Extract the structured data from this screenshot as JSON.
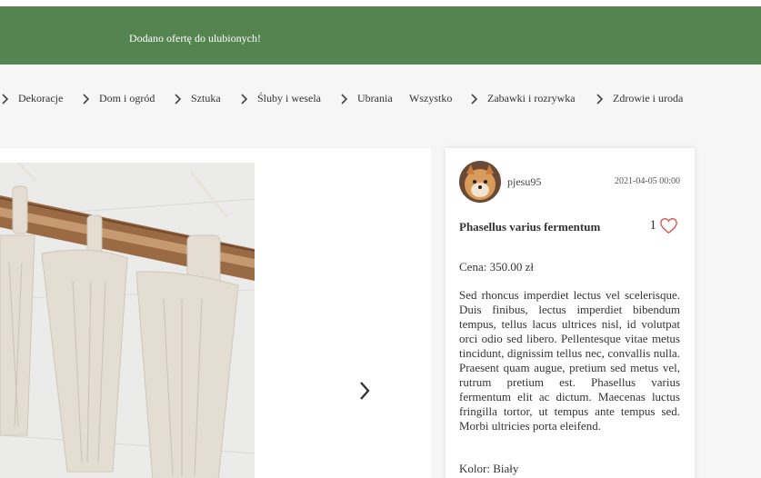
{
  "notification": {
    "message": "Dodano ofertę do ulubionych!"
  },
  "categories": [
    {
      "label": "Dekoracje",
      "chevron": true
    },
    {
      "label": "Dom i ogród",
      "chevron": true
    },
    {
      "label": "Sztuka",
      "chevron": true
    },
    {
      "label": "Śluby i wesela",
      "chevron": true
    },
    {
      "label": "Ubrania",
      "chevron": true
    },
    {
      "label": "Wszystko",
      "chevron": false
    },
    {
      "label": "Zabawki i rozrywka",
      "chevron": true
    },
    {
      "label": "Zdrowie i uroda",
      "chevron": true
    }
  ],
  "gallery": {
    "next_icon": "chevron-right-icon"
  },
  "offer": {
    "username": "pjesu95",
    "date": "2021-04-05 00:00",
    "title": "Phasellus varius fermentum",
    "likes": "1",
    "like_icon": "heart-outline-icon",
    "like_color": "#d9534f",
    "price": "Cena: 350.00 zł",
    "description": "Sed rhoncus imperdiet lectus vel scelerisque. Duis finibus, lectus imperdiet bibendum tempus, tellus lacus ultrices nisl, id volutpat orci odio sed libero. Pellentesque vitae metus tincidunt, dignissim tellus nec, convallis nulla. Praesent quam augue, pretium sed metus vel, rutrum pretium est. Phasellus varius fermentum elit ac dictum. Maecenas luctus fringilla tortor, ut tempus ante tempus sed. Morbi ultricies porta eleifend.",
    "color": "Kolor: Biały"
  },
  "colors": {
    "banner": "#548550",
    "accent_heart": "#d9534f"
  }
}
